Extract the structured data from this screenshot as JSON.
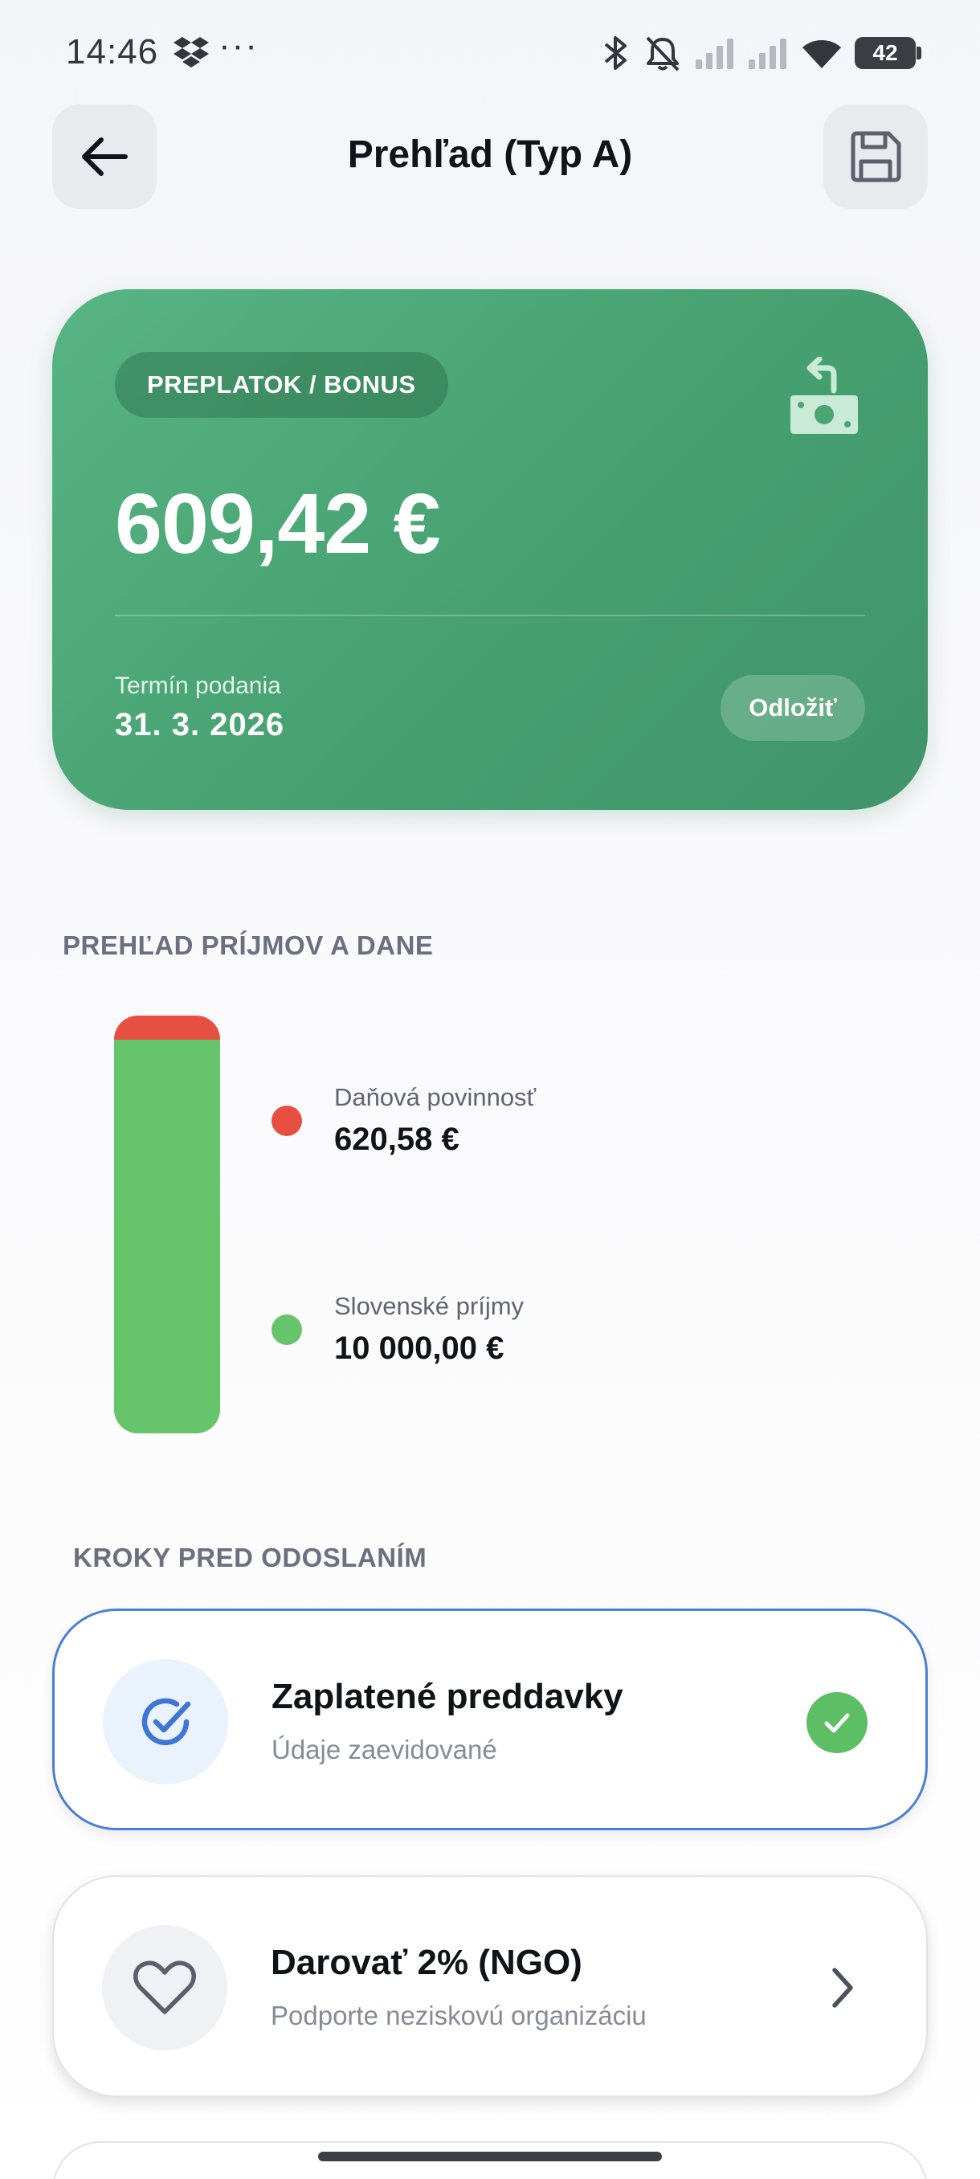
{
  "status_bar": {
    "time": "14:46",
    "dots": "···",
    "battery": "42",
    "icons": [
      "dropbox-icon",
      "bluetooth-icon",
      "mute-vibrate-icon",
      "signal-icon",
      "signal-icon",
      "wifi-icon",
      "battery-icon"
    ]
  },
  "header": {
    "title": "Prehľad (Typ A)",
    "back_icon": "arrow-left-icon",
    "save_icon": "save-icon"
  },
  "result": {
    "badge": "PREPLATOK / BONUS",
    "amount": "609,42 €",
    "deadline_label": "Termín podania",
    "deadline_value": "31. 3. 2026",
    "postpone_label": "Odložiť",
    "icon": "money-refund-icon",
    "colors": {
      "card_start": "#57b583",
      "card_end": "#3f956a"
    }
  },
  "overview": {
    "section_title": "PREHĽAD PRÍJMOV A DANE",
    "tax": {
      "label": "Daňová povinnosť",
      "value": "620,58 €",
      "amount": 620.58,
      "color": "#e84f43"
    },
    "income": {
      "label": "Slovenské príjmy",
      "value": "10 000,00 €",
      "amount": 10000.0,
      "color": "#66c56b"
    }
  },
  "steps": {
    "section_title": "KROKY PRED ODOSLANÍM",
    "items": [
      {
        "title": "Zaplatené preddavky",
        "subtitle": "Údaje zaevidované",
        "icon": "check-circle-icon",
        "status": "done"
      },
      {
        "title": "Darovať 2% (NGO)",
        "subtitle": "Podporte neziskovú organizáciu",
        "icon": "heart-icon",
        "status": "open"
      }
    ]
  }
}
